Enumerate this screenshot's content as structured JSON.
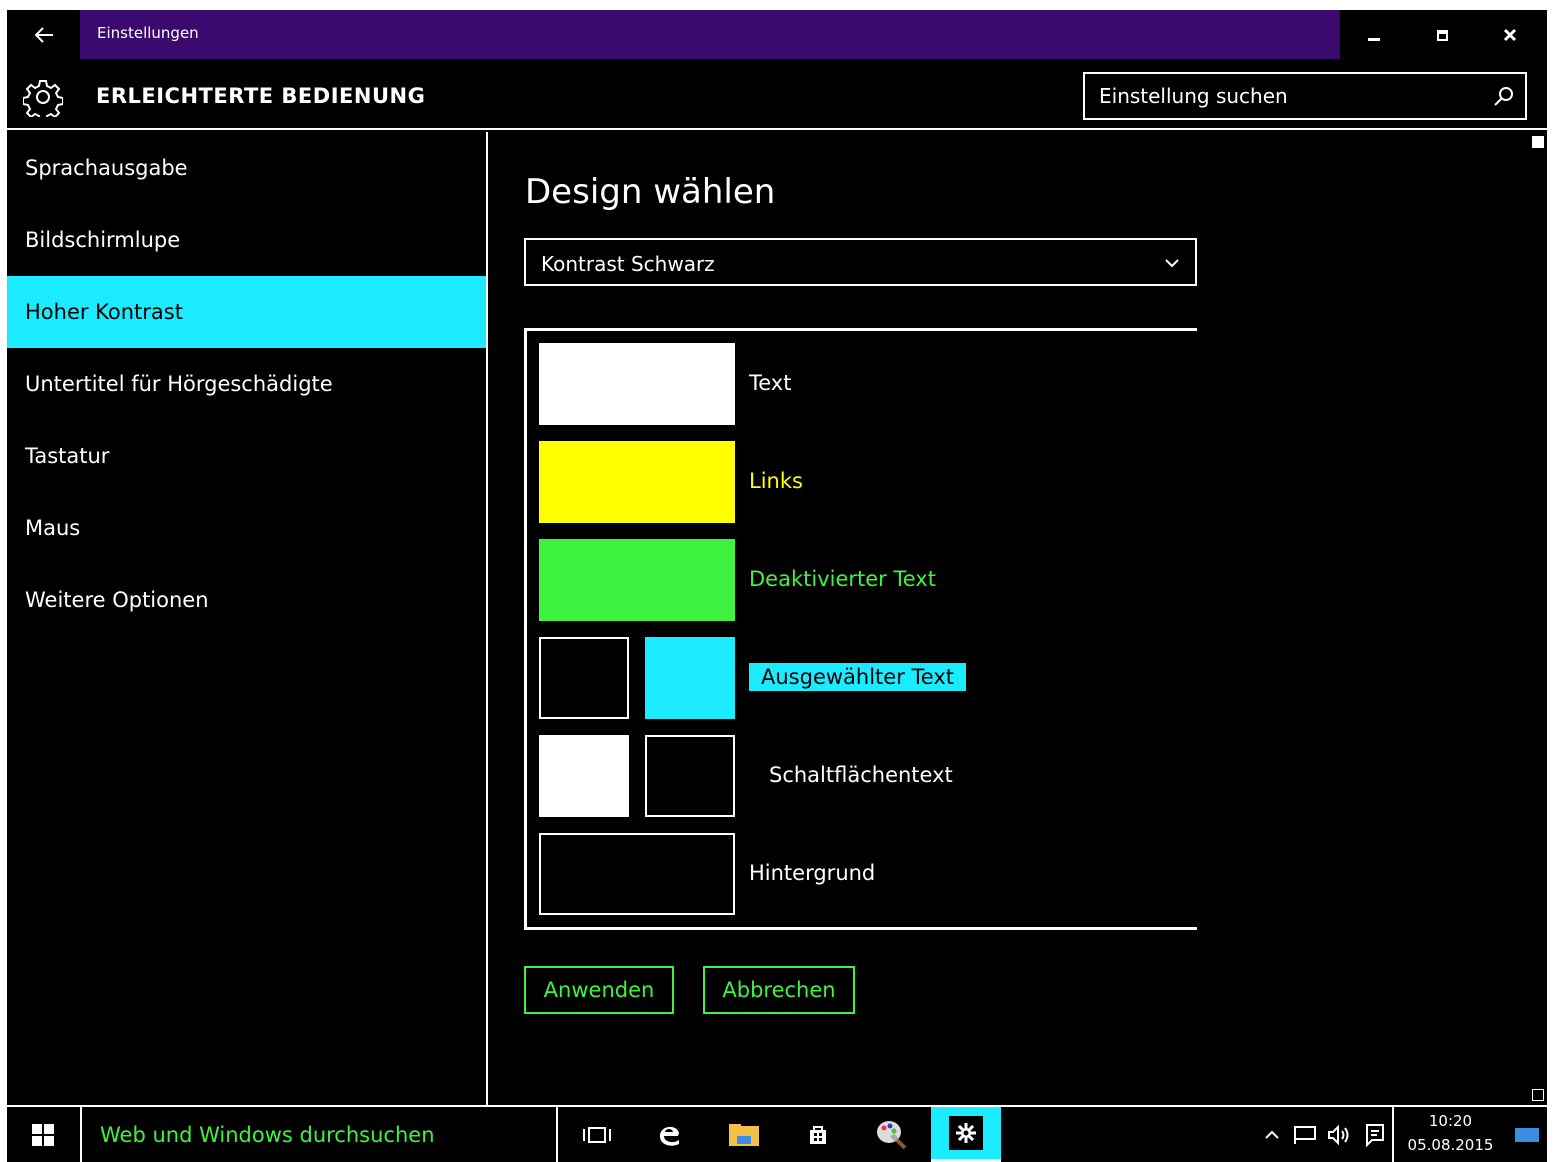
{
  "window": {
    "title": "Einstellungen",
    "back_icon": "back-arrow-icon",
    "controls": [
      "minimize",
      "restore",
      "close"
    ]
  },
  "header": {
    "title": "ERLEICHTERTE BEDIENUNG",
    "icon": "gear-icon",
    "search_placeholder": "Einstellung suchen"
  },
  "sidebar": {
    "items": [
      {
        "label": "Sprachausgabe",
        "active": false
      },
      {
        "label": "Bildschirmlupe",
        "active": false
      },
      {
        "label": "Hoher Kontrast",
        "active": true
      },
      {
        "label": "Untertitel für Hörgeschädigte",
        "active": false
      },
      {
        "label": "Tastatur",
        "active": false
      },
      {
        "label": "Maus",
        "active": false
      },
      {
        "label": "Weitere Optionen",
        "active": false
      }
    ]
  },
  "main": {
    "heading": "Design wählen",
    "theme_select": {
      "value": "Kontrast Schwarz"
    },
    "preview": [
      {
        "label": "Text",
        "colors": [
          "#ffffff"
        ],
        "label_color": "#ffffff"
      },
      {
        "label": "Links",
        "colors": [
          "#ffff00"
        ],
        "label_color": "#ffff00"
      },
      {
        "label": "Deaktivierter Text",
        "colors": [
          "#3ff23f"
        ],
        "label_color": "#3ff23f"
      },
      {
        "label": "Ausgewählter Text",
        "colors": [
          "#000000",
          "#1aebff"
        ],
        "label_color": "#000000"
      },
      {
        "label": "Schaltflächentext",
        "colors": [
          "#ffffff",
          "#000000"
        ],
        "label_color": "#ffffff"
      },
      {
        "label": "Hintergrund",
        "colors": [
          "#000000"
        ],
        "label_color": "#ffffff"
      }
    ],
    "apply_label": "Anwenden",
    "cancel_label": "Abbrechen"
  },
  "taskbar": {
    "search_text": "Web und Windows durchsuchen",
    "time": "10:20",
    "date": "05.08.2015",
    "pinned_icons": [
      "task-view-icon",
      "edge-icon",
      "file-explorer-icon",
      "store-icon",
      "paint-icon",
      "settings-icon"
    ]
  },
  "colors": {
    "accent_purple": "#3b0a6e",
    "highlight_cyan": "#1aebff",
    "disabled_green": "#3ff23f",
    "link_yellow": "#ffff00"
  }
}
